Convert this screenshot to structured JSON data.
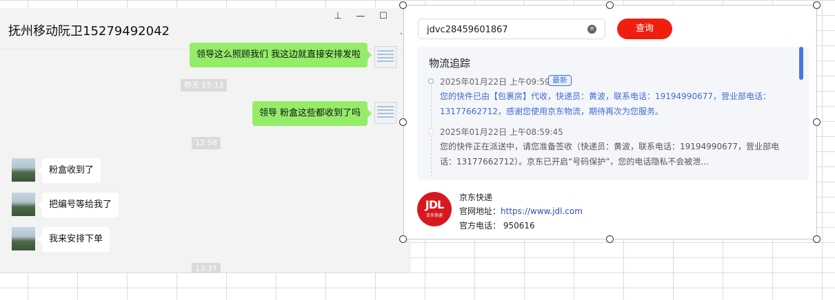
{
  "chat": {
    "title": "抚州移动阮卫15279492042",
    "window_controls": {
      "pin": "⊥",
      "minimize": "—",
      "maximize": "☐"
    },
    "menu_dots": "·",
    "messages": [
      {
        "text": "领导这么照顾我们 我这边就直接安排发啦"
      },
      {
        "timestamp": "昨天 15:13"
      },
      {
        "text": "领导 粉盒这些都收到了吗"
      },
      {
        "timestamp": "12:58"
      },
      {
        "text": "粉盒收到了"
      },
      {
        "text": "把编号等给我了"
      },
      {
        "text": "我来安排下单"
      },
      {
        "timestamp": "13:37"
      }
    ]
  },
  "tracker": {
    "search": {
      "value": "jdvc28459601867",
      "clear_icon": "×"
    },
    "query_button": "查询",
    "section_title": "物流追踪",
    "events": [
      {
        "time": "2025年01月22日 上午09:59:54",
        "badge": "最新",
        "desc": "您的快件已由【包裹房】代收，快递员：黄波，联系电话：19194990677，营业部电话：13177662712，感谢您使用京东物流，期待再次为您服务。"
      },
      {
        "time": "2025年01月22日 上午08:59:45",
        "desc": "您的快件正在派送中，请您准备签收（快递员：黄波，联系电话：19194990677，营业部电话：13177662712）。京东已开启“号码保护”，您的电话隐私不会被泄..."
      }
    ],
    "company": {
      "logo_text": "JDL",
      "logo_sub": "京东快递",
      "name": "京东快递",
      "website_label": "官网地址：",
      "website": "https://www.jdl.com",
      "phone_label": "官方电话：",
      "phone": "950616"
    },
    "colors": {
      "accent": "#f01e0f",
      "link": "#3e6bd6",
      "panel": "#f4f6fa"
    }
  }
}
